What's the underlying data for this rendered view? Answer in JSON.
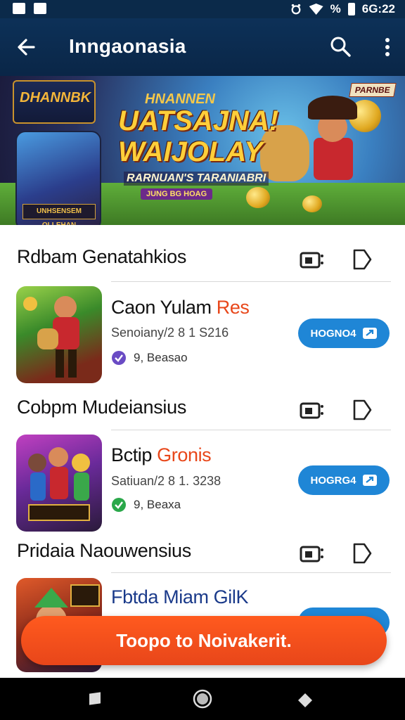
{
  "status_bar": {
    "time": "6G:22",
    "battery_text": "%"
  },
  "app_bar": {
    "title": "Inngaonasia"
  },
  "banner": {
    "logo_text": "DHANNBK",
    "subtitle": "HNANNEN",
    "headline_line1": "UATSAJNA!",
    "headline_line2": "WAIJOLAY",
    "tagline": "RARNUAN'S TARANIABRI",
    "pill": "JUNG BG HOAG",
    "badge": "PARNBE",
    "thumb_title": "UNHSENSEM OLLEHAN"
  },
  "sections": [
    {
      "title": "Rdbam Genatahkios",
      "app": {
        "name": "Caon Yulam",
        "name_accent": "Res",
        "meta": "Senoiany/2 8 1 S216",
        "rating": "9, Beasao",
        "install_label": "HOGNO4",
        "rating_color": "#6a4bc4"
      }
    },
    {
      "title": "Cobpm Mudeiansius",
      "app": {
        "name": "Bctip",
        "name_accent": "Gronis",
        "meta": "Satiuan/2 8 1. 3238",
        "rating": "9, Beaxa",
        "install_label": "HOGRG4",
        "rating_color": "#2aa84a"
      }
    },
    {
      "title": "Pridaia Naouwensius",
      "app": {
        "name": "Fbtda Miam GilK",
        "name_accent": "",
        "meta": "",
        "rating": "",
        "install_label": ""
      }
    }
  ],
  "toast": {
    "text": "Toopo to Noivakerit."
  },
  "colors": {
    "app_bar": "#0d3158",
    "accent": "#e8471a",
    "button": "#1f86d6",
    "toast": "#ff5a1e"
  }
}
